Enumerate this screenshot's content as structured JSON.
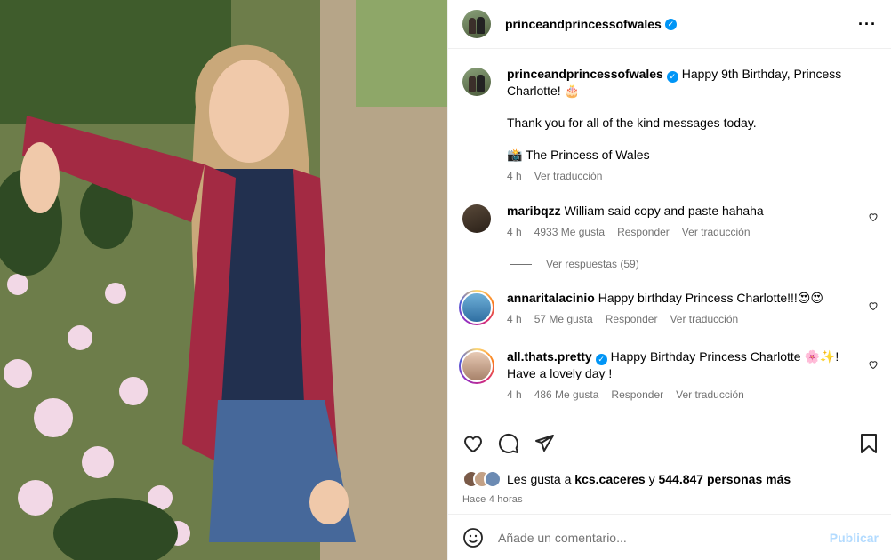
{
  "post": {
    "author": "princeandprincessofwales",
    "caption_line1": "Happy 9th Birthday, Princess Charlotte! 🎂",
    "caption_line2": "Thank you for all of the kind messages today.",
    "caption_line3": "📸 The Princess of Wales",
    "time": "4 h",
    "translate": "Ver traducción"
  },
  "comments": [
    {
      "user": "maribqzz",
      "text": "William said copy and paste hahaha",
      "time": "4 h",
      "likes": "4933 Me gusta",
      "reply": "Responder",
      "translate": "Ver traducción"
    },
    {
      "user": "annaritalacinio",
      "text": "Happy birthday Princess Charlotte!!!😍😍",
      "time": "4 h",
      "likes": "57 Me gusta",
      "reply": "Responder",
      "translate": "Ver traducción"
    },
    {
      "user": "all.thats.pretty",
      "text": "Happy Birthday Princess Charlotte 🌸✨! Have a lovely day !",
      "time": "4 h",
      "likes": "486 Me gusta",
      "reply": "Responder",
      "translate": "Ver traducción"
    }
  ],
  "view_replies": "Ver respuestas (59)",
  "likes": {
    "prefix": "Les gusta a ",
    "user": "kcs.caceres",
    "mid": " y ",
    "count": "544.847 personas más"
  },
  "posted_ago": "Hace 4 horas",
  "add_comment": {
    "placeholder": "Añade un comentario...",
    "publish": "Publicar"
  },
  "colors": {
    "verified": "#0095f6",
    "muted": "#737373",
    "publish": "#b3dbff"
  }
}
